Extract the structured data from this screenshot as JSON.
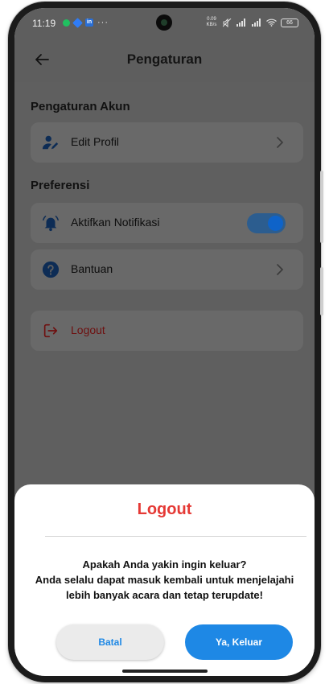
{
  "status_bar": {
    "time": "11:19",
    "more_indicator": "···",
    "speed_label": "0.09 KB/s",
    "battery": "66"
  },
  "app_bar": {
    "title": "Pengaturan",
    "back_icon": "arrow-left-icon"
  },
  "sections": [
    {
      "title": "Pengaturan Akun",
      "items": [
        {
          "label": "Edit Profil",
          "icon": "user-edit-icon",
          "trailing": "chevron-right-icon"
        }
      ]
    },
    {
      "title": "Preferensi",
      "items": [
        {
          "label": "Aktifkan Notifikasi",
          "icon": "bell-ring-icon",
          "trailing": "toggle",
          "toggle_on": true
        },
        {
          "label": "Bantuan",
          "icon": "help-circle-icon",
          "trailing": "chevron-right-icon"
        }
      ]
    }
  ],
  "logout_item": {
    "label": "Logout",
    "icon": "logout-icon"
  },
  "dialog": {
    "title": "Logout",
    "message_lines": [
      "Apakah Anda yakin ingin keluar?",
      "Anda selalu dapat masuk kembali untuk menjelajahi",
      "lebih banyak acara dan tetap terupdate!"
    ],
    "cancel_label": "Batal",
    "confirm_label": "Ya, Keluar"
  },
  "colors": {
    "accent_blue": "#1e88e5",
    "danger_red": "#e53935",
    "overlay_bg": "#5f5f5f"
  }
}
